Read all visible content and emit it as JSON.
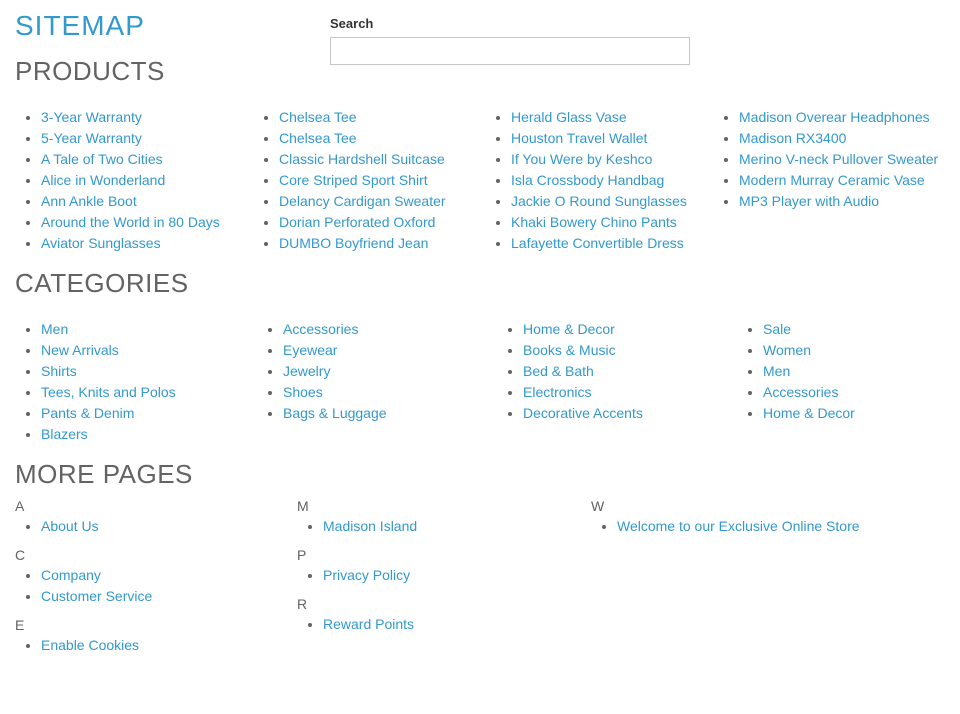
{
  "titles": {
    "page": "SITEMAP",
    "products": "PRODUCTS",
    "categories": "CATEGORIES",
    "more_pages": "MORE PAGES"
  },
  "search": {
    "label": "Search",
    "value": ""
  },
  "products": {
    "col1": [
      "3-Year Warranty",
      "5-Year Warranty",
      "A Tale of Two Cities",
      "Alice in Wonderland",
      "Ann Ankle Boot",
      "Around the World in 80 Days",
      "Aviator Sunglasses"
    ],
    "col2": [
      "Chelsea Tee",
      "Chelsea Tee",
      "Classic Hardshell Suitcase",
      "Core Striped Sport Shirt",
      "Delancy Cardigan Sweater",
      "Dorian Perforated Oxford",
      "DUMBO Boyfriend Jean"
    ],
    "col3": [
      "Herald Glass Vase",
      "Houston Travel Wallet",
      "If You Were by Keshco",
      "Isla Crossbody Handbag",
      "Jackie O Round Sunglasses",
      "Khaki Bowery Chino Pants",
      "Lafayette Convertible Dress"
    ],
    "col4": [
      "Madison Overear Headphones",
      "Madison RX3400",
      "Merino V-neck Pullover Sweater",
      "Modern Murray Ceramic Vase",
      "MP3 Player with Audio"
    ]
  },
  "categories": {
    "col1": [
      "Men",
      "New Arrivals",
      "Shirts",
      "Tees, Knits and Polos",
      "Pants & Denim",
      "Blazers"
    ],
    "col2": [
      "Accessories",
      "Eyewear",
      "Jewelry",
      "Shoes",
      "Bags & Luggage"
    ],
    "col3": [
      "Home & Decor",
      "Books & Music",
      "Bed & Bath",
      "Electronics",
      "Decorative Accents"
    ],
    "col4": [
      "Sale",
      "Women",
      "Men",
      "Accessories",
      "Home & Decor"
    ]
  },
  "more_pages": {
    "col1": [
      {
        "letter": "A",
        "links": [
          "About Us"
        ]
      },
      {
        "letter": "C",
        "links": [
          "Company",
          "Customer Service"
        ]
      },
      {
        "letter": "E",
        "links": [
          "Enable Cookies"
        ]
      }
    ],
    "col2": [
      {
        "letter": "M",
        "links": [
          "Madison Island"
        ]
      },
      {
        "letter": "P",
        "links": [
          "Privacy Policy"
        ]
      },
      {
        "letter": "R",
        "links": [
          "Reward Points"
        ]
      }
    ],
    "col3": [
      {
        "letter": "W",
        "links": [
          "Welcome to our Exclusive Online Store"
        ]
      }
    ]
  }
}
